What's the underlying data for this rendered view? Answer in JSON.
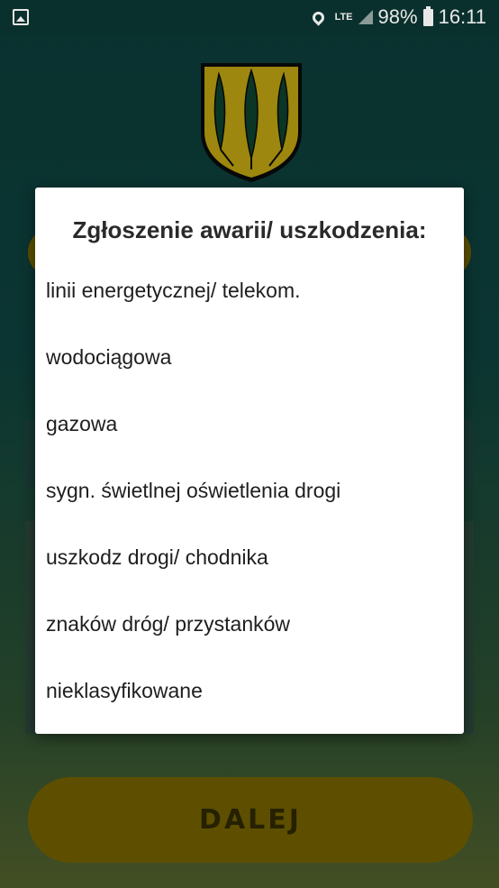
{
  "status_bar": {
    "lte": "LTE",
    "battery": "98%",
    "time": "16:11"
  },
  "colors": {
    "background": "#0d3d39",
    "button": "#6b5a00",
    "crest_yellow": "#b39a10",
    "crest_green": "#0d3d2a"
  },
  "next_button": {
    "label": "DALEJ"
  },
  "dialog": {
    "title": "Zgłoszenie awarii/ uszkodzenia:",
    "options": [
      "linii energetycznej/ telekom.",
      "wodociągowa",
      "gazowa",
      "sygn. świetlnej oświetlenia drogi",
      "uszkodz drogi/ chodnika",
      "znaków dróg/ przystanków",
      "nieklasyfikowane"
    ]
  }
}
